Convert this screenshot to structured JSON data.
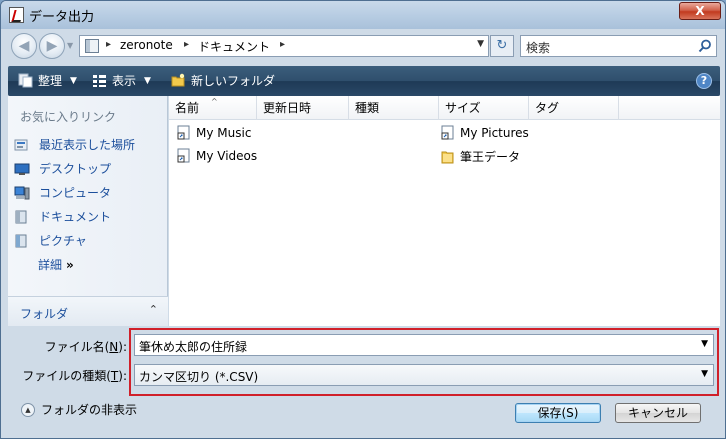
{
  "window": {
    "title": "データ出力",
    "close_label": "X"
  },
  "nav": {
    "address_segments": [
      "zeronote",
      "ドキュメント"
    ],
    "search_placeholder": "検索"
  },
  "toolbar": {
    "organize_label": "整理",
    "view_label": "表示",
    "new_folder_label": "新しいフォルダ",
    "help_label": "?"
  },
  "sidebar": {
    "header": "お気に入りリンク",
    "items": [
      {
        "label": "最近表示した場所",
        "icon": "recent-places-icon"
      },
      {
        "label": "デスクトップ",
        "icon": "desktop-icon"
      },
      {
        "label": "コンピュータ",
        "icon": "computer-icon"
      },
      {
        "label": "ドキュメント",
        "icon": "documents-icon"
      },
      {
        "label": "ピクチャ",
        "icon": "pictures-icon"
      }
    ],
    "more_label": "詳細",
    "more_arrow": "»",
    "folder_label": "フォルダ"
  },
  "files": {
    "columns": [
      "名前",
      "更新日時",
      "種類",
      "サイズ",
      "タグ"
    ],
    "items": [
      {
        "name": "My Music",
        "icon": "shortcut-icon"
      },
      {
        "name": "My Videos",
        "icon": "shortcut-icon"
      },
      {
        "name": "My Pictures",
        "icon": "shortcut-icon"
      },
      {
        "name": "筆王データ",
        "icon": "folder-icon"
      }
    ]
  },
  "form": {
    "filename_label_prefix": "ファイル名(",
    "filename_label_key": "N",
    "filename_label_suffix": "):",
    "filename_value": "筆休め太郎の住所録",
    "filetype_label_prefix": "ファイルの種類(",
    "filetype_label_key": "T",
    "filetype_label_suffix": "):",
    "filetype_value": "カンマ区切り (*.CSV)",
    "hide_folders_label": "フォルダの非表示",
    "save_label": "保存(S)",
    "cancel_label": "キャンセル"
  },
  "colors": {
    "highlight_border": "#d0202a",
    "link": "#1c4f9c",
    "toolbar": "#2f4f6d"
  }
}
